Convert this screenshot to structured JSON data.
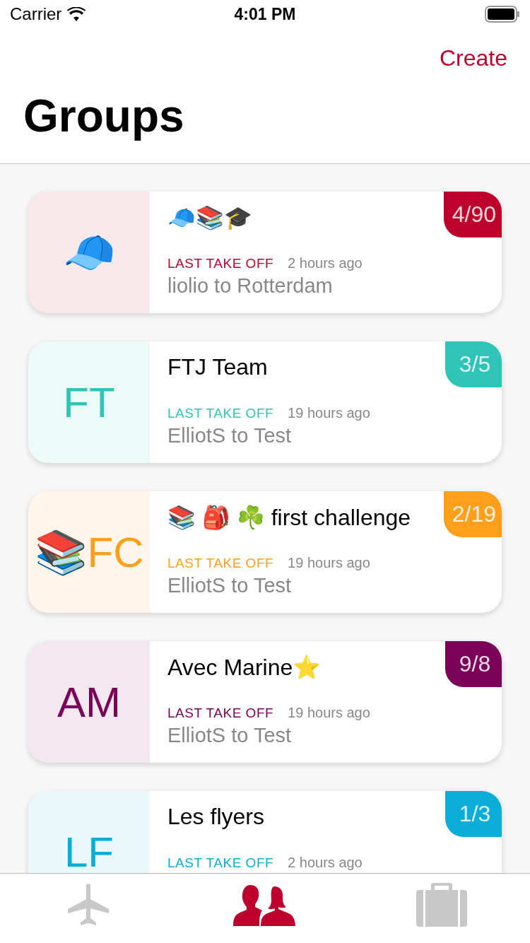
{
  "status_bar": {
    "carrier": "Carrier",
    "time": "4:01 PM"
  },
  "nav": {
    "action": "Create",
    "title": "Groups"
  },
  "groups": [
    {
      "avatar": "🧢",
      "title": "🧢📚🎓",
      "badge": "4/90",
      "color": "#bd002b",
      "label": "LAST TAKE OFF",
      "time": "2 hours ago",
      "subtitle": "liolio to Rotterdam"
    },
    {
      "avatar": "FT",
      "title": "FTJ Team",
      "badge": "3/5",
      "color": "#2ec4b6",
      "label": "LAST TAKE OFF",
      "time": "19 hours ago",
      "subtitle": "ElliotS to Test"
    },
    {
      "avatar": "📚FC",
      "title": "📚 🎒 ☘️ first challenge",
      "badge": "2/19",
      "color": "#ff9f1c",
      "label": "LAST TAKE OFF",
      "time": "19 hours ago",
      "subtitle": "ElliotS to Test"
    },
    {
      "avatar": "AM",
      "title": "Avec Marine⭐",
      "badge": "9/8",
      "color": "#7a0058",
      "label": "LAST TAKE OFF",
      "time": "19 hours ago",
      "subtitle": "ElliotS to Test"
    },
    {
      "avatar": "LF",
      "title": "Les flyers",
      "badge": "1/3",
      "color": "#0aadd6",
      "label": "LAST TAKE OFF",
      "time": "2 hours ago"
    }
  ],
  "tab_bar": [
    {
      "kind": "flights",
      "selected": false
    },
    {
      "kind": "groups",
      "selected": true
    },
    {
      "kind": "trips",
      "selected": false
    }
  ]
}
